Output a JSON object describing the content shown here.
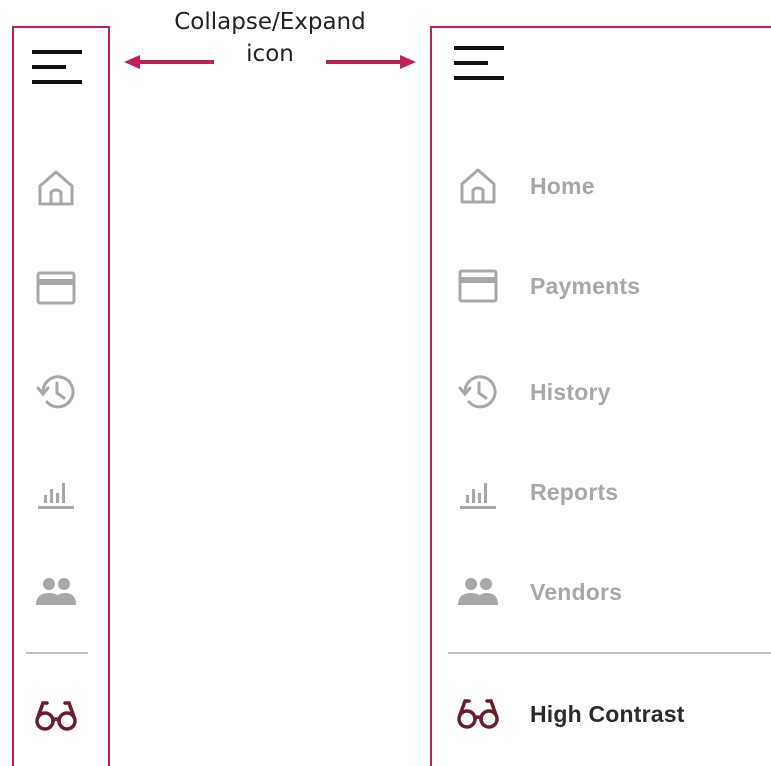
{
  "annotation": {
    "text": "Collapse/Expand\nicon"
  },
  "colors": {
    "accent": "#C41E5A",
    "icon_inactive": "#A8A8A8",
    "icon_active": "#6B1D2E",
    "label_active": "#2B2B2B",
    "divider": "#BFBFBF"
  },
  "sidebar_collapsed": {
    "toggle_icon": "hamburger-icon"
  },
  "sidebar_expanded": {
    "toggle_icon": "hamburger-icon"
  },
  "nav": {
    "items": [
      {
        "label": "Home",
        "icon": "home-icon"
      },
      {
        "label": "Payments",
        "icon": "credit-card-icon"
      },
      {
        "label": "History",
        "icon": "history-icon"
      },
      {
        "label": "Reports",
        "icon": "bar-chart-icon"
      },
      {
        "label": "Vendors",
        "icon": "people-icon"
      }
    ],
    "high_contrast": {
      "label": "High Contrast",
      "icon": "glasses-icon"
    }
  }
}
